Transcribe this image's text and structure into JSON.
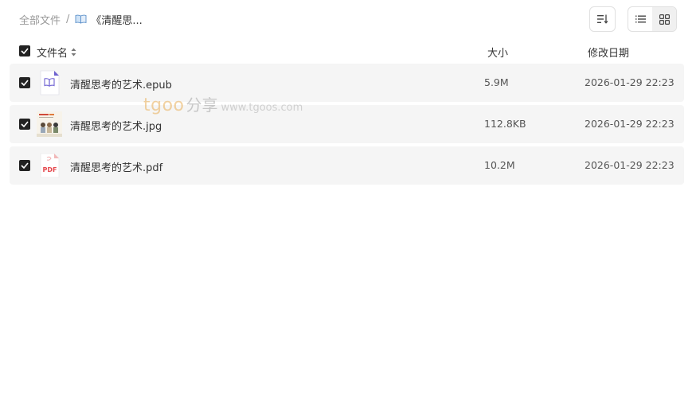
{
  "breadcrumb": {
    "root_label": "全部文件",
    "separator": "/",
    "current_label": "《清醒思..."
  },
  "toolbar": {
    "sort_icon": "sort-lines-icon",
    "list_view_icon": "list-view-icon",
    "grid_view_icon": "grid-view-icon"
  },
  "table": {
    "headers": {
      "name": "文件名",
      "size": "大小",
      "date": "修改日期"
    },
    "rows": [
      {
        "name": "清醒思考的艺术.epub",
        "size": "5.9M",
        "date": "2026-01-29 22:23",
        "type": "epub"
      },
      {
        "name": "清醒思考的艺术.jpg",
        "size": "112.8KB",
        "date": "2026-01-29 22:23",
        "type": "jpg"
      },
      {
        "name": "清醒思考的艺术.pdf",
        "size": "10.2M",
        "date": "2026-01-29 22:23",
        "type": "pdf",
        "badge": "PDF"
      }
    ]
  },
  "watermark": {
    "brand": "tgoo",
    "cn": "分享",
    "url": "www.tgoos.com"
  },
  "colors": {
    "row_bg": "#f5f5f5",
    "checkbox": "#222222",
    "pdf_red": "#e5484d",
    "epub_purple": "#7b6fd6"
  }
}
